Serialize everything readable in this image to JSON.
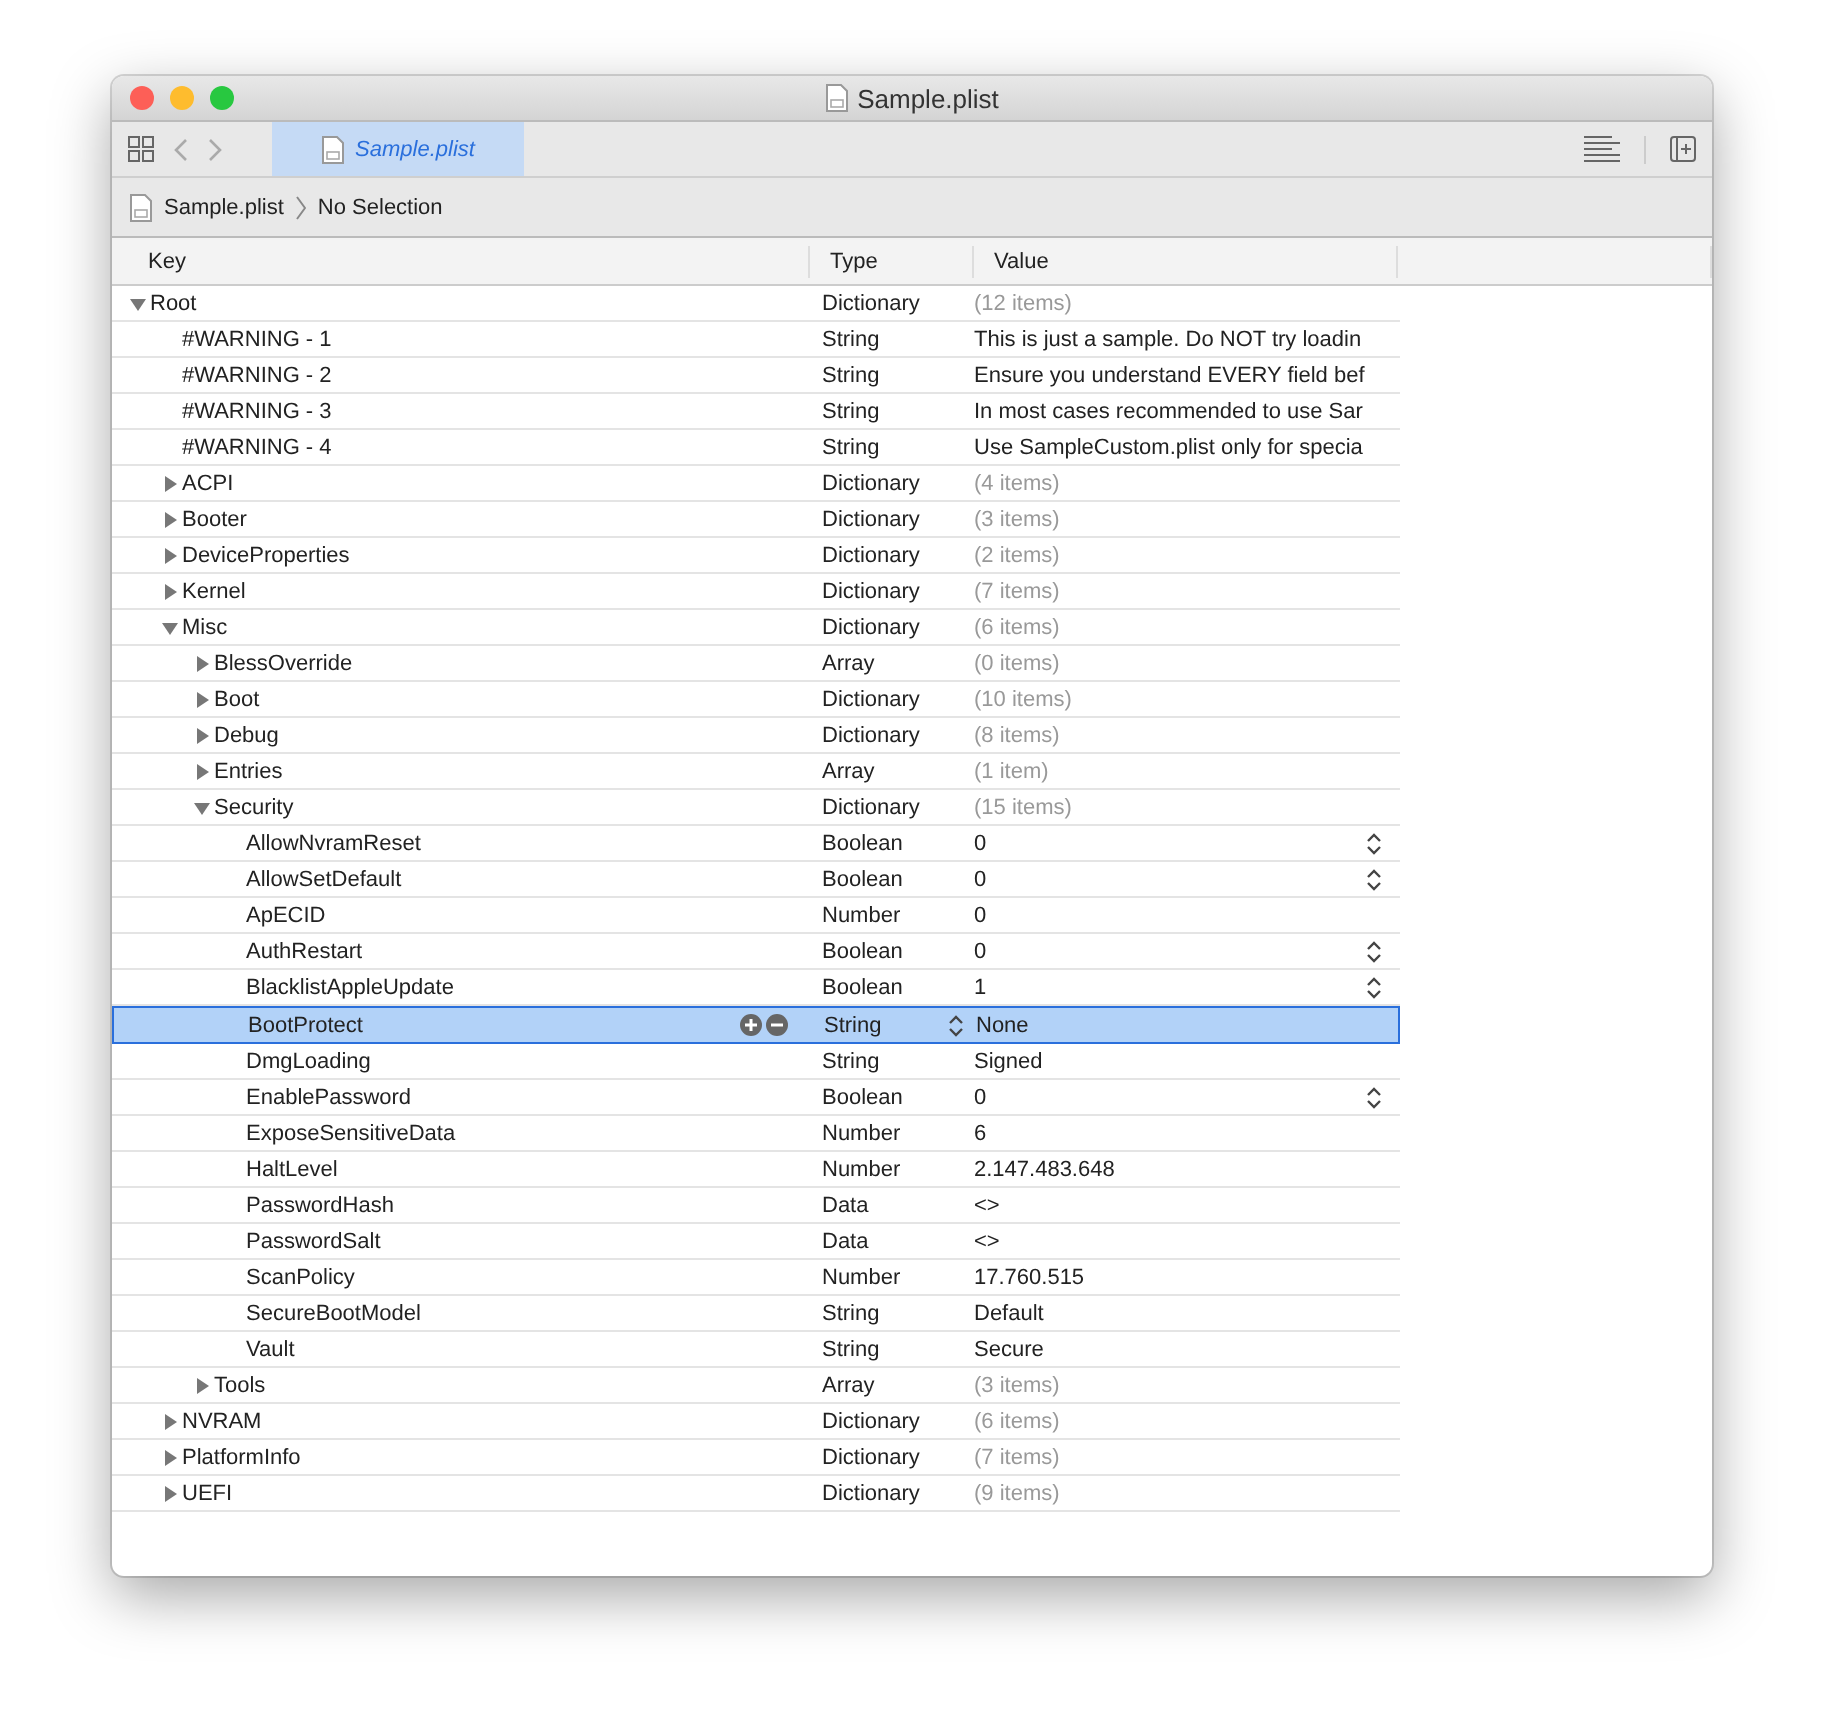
{
  "window": {
    "title": "Sample.plist"
  },
  "tab": {
    "label": "Sample.plist",
    "selected": true
  },
  "path_bar": {
    "file": "Sample.plist",
    "selection": "No Selection"
  },
  "table": {
    "columns": [
      "Key",
      "Type",
      "Value"
    ],
    "rows": [
      {
        "key": "Root",
        "type": "Dictionary",
        "value": "(12 items)",
        "expanded": true,
        "selected": false,
        "children": [
          {
            "key": "#WARNING - 1",
            "type": "String",
            "value": "This is just a sample. Do NOT try loadin",
            "selected": false
          },
          {
            "key": "#WARNING - 2",
            "type": "String",
            "value": "Ensure you understand EVERY field bef",
            "selected": false
          },
          {
            "key": "#WARNING - 3",
            "type": "String",
            "value": "In most cases recommended to use Sar",
            "selected": false
          },
          {
            "key": "#WARNING - 4",
            "type": "String",
            "value": "Use SampleCustom.plist only for specia",
            "selected": false
          },
          {
            "key": "ACPI",
            "type": "Dictionary",
            "value": "(4 items)",
            "expanded": false,
            "selected": false
          },
          {
            "key": "Booter",
            "type": "Dictionary",
            "value": "(3 items)",
            "expanded": false,
            "selected": false
          },
          {
            "key": "DeviceProperties",
            "type": "Dictionary",
            "value": "(2 items)",
            "expanded": false,
            "selected": false
          },
          {
            "key": "Kernel",
            "type": "Dictionary",
            "value": "(7 items)",
            "expanded": false,
            "selected": false
          },
          {
            "key": "Misc",
            "type": "Dictionary",
            "value": "(6 items)",
            "expanded": true,
            "selected": false,
            "children": [
              {
                "key": "BlessOverride",
                "type": "Array",
                "value": "(0 items)",
                "expanded": false,
                "selected": false
              },
              {
                "key": "Boot",
                "type": "Dictionary",
                "value": "(10 items)",
                "expanded": false,
                "selected": false
              },
              {
                "key": "Debug",
                "type": "Dictionary",
                "value": "(8 items)",
                "expanded": false,
                "selected": false
              },
              {
                "key": "Entries",
                "type": "Array",
                "value": "(1 item)",
                "expanded": false,
                "selected": false
              },
              {
                "key": "Security",
                "type": "Dictionary",
                "value": "(15 items)",
                "expanded": true,
                "selected": false,
                "children": [
                  {
                    "key": "AllowNvramReset",
                    "type": "Boolean",
                    "value": "0",
                    "value_menu": true,
                    "selected": false
                  },
                  {
                    "key": "AllowSetDefault",
                    "type": "Boolean",
                    "value": "0",
                    "value_menu": true,
                    "selected": false
                  },
                  {
                    "key": "ApECID",
                    "type": "Number",
                    "value": "0",
                    "selected": false
                  },
                  {
                    "key": "AuthRestart",
                    "type": "Boolean",
                    "value": "0",
                    "value_menu": true,
                    "selected": false
                  },
                  {
                    "key": "BlacklistAppleUpdate",
                    "type": "Boolean",
                    "value": "1",
                    "value_menu": true,
                    "selected": false
                  },
                  {
                    "key": "BootProtect",
                    "type": "String",
                    "value": "None",
                    "selected": true
                  },
                  {
                    "key": "DmgLoading",
                    "type": "String",
                    "value": "Signed",
                    "selected": false
                  },
                  {
                    "key": "EnablePassword",
                    "type": "Boolean",
                    "value": "0",
                    "value_menu": true,
                    "selected": false
                  },
                  {
                    "key": "ExposeSensitiveData",
                    "type": "Number",
                    "value": "6",
                    "selected": false
                  },
                  {
                    "key": "HaltLevel",
                    "type": "Number",
                    "value": "2.147.483.648",
                    "selected": false
                  },
                  {
                    "key": "PasswordHash",
                    "type": "Data",
                    "value": "<>",
                    "selected": false
                  },
                  {
                    "key": "PasswordSalt",
                    "type": "Data",
                    "value": "<>",
                    "selected": false
                  },
                  {
                    "key": "ScanPolicy",
                    "type": "Number",
                    "value": "17.760.515",
                    "selected": false
                  },
                  {
                    "key": "SecureBootModel",
                    "type": "String",
                    "value": "Default",
                    "selected": false
                  },
                  {
                    "key": "Vault",
                    "type": "String",
                    "value": "Secure",
                    "selected": false
                  }
                ]
              },
              {
                "key": "Tools",
                "type": "Array",
                "value": "(3 items)",
                "expanded": false,
                "selected": false
              }
            ]
          },
          {
            "key": "NVRAM",
            "type": "Dictionary",
            "value": "(6 items)",
            "expanded": false,
            "selected": false
          },
          {
            "key": "PlatformInfo",
            "type": "Dictionary",
            "value": "(7 items)",
            "expanded": false,
            "selected": false
          },
          {
            "key": "UEFI",
            "type": "Dictionary",
            "value": "(9 items)",
            "expanded": false,
            "selected": false
          }
        ]
      }
    ]
  }
}
